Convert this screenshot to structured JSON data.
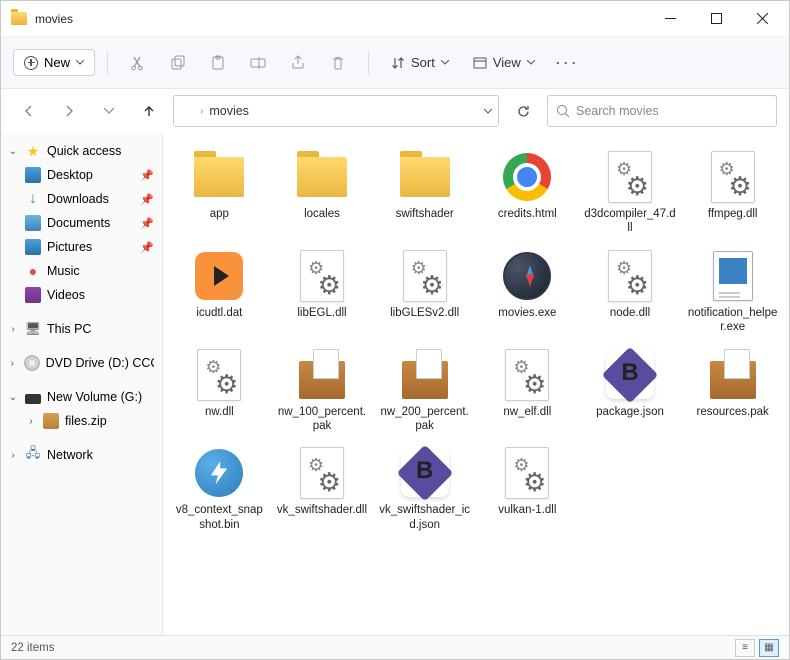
{
  "window": {
    "title": "movies"
  },
  "toolbar": {
    "new_label": "New",
    "sort_label": "Sort",
    "view_label": "View"
  },
  "address": {
    "crumb": "movies"
  },
  "search": {
    "placeholder": "Search movies"
  },
  "sidebar": {
    "quick_access": "Quick access",
    "desktop": "Desktop",
    "downloads": "Downloads",
    "documents": "Documents",
    "pictures": "Pictures",
    "music": "Music",
    "videos": "Videos",
    "this_pc": "This PC",
    "dvd": "DVD Drive (D:) CCCC",
    "new_volume": "New Volume (G:)",
    "files_zip": "files.zip",
    "network": "Network"
  },
  "files": [
    {
      "name": "app",
      "type": "folder"
    },
    {
      "name": "locales",
      "type": "folder"
    },
    {
      "name": "swiftshader",
      "type": "folder"
    },
    {
      "name": "credits.html",
      "type": "chrome"
    },
    {
      "name": "d3dcompiler_47.dll",
      "type": "gear"
    },
    {
      "name": "ffmpeg.dll",
      "type": "gear"
    },
    {
      "name": "icudtl.dat",
      "type": "play"
    },
    {
      "name": "libEGL.dll",
      "type": "gear"
    },
    {
      "name": "libGLESv2.dll",
      "type": "gear"
    },
    {
      "name": "movies.exe",
      "type": "compass"
    },
    {
      "name": "node.dll",
      "type": "gear"
    },
    {
      "name": "notification_helper.exe",
      "type": "doc"
    },
    {
      "name": "nw.dll",
      "type": "gear"
    },
    {
      "name": "nw_100_percent.pak",
      "type": "box"
    },
    {
      "name": "nw_200_percent.pak",
      "type": "box"
    },
    {
      "name": "nw_elf.dll",
      "type": "gear"
    },
    {
      "name": "package.json",
      "type": "bbedit"
    },
    {
      "name": "resources.pak",
      "type": "box"
    },
    {
      "name": "v8_context_snapshot.bin",
      "type": "daemon"
    },
    {
      "name": "vk_swiftshader.dll",
      "type": "gear"
    },
    {
      "name": "vk_swiftshader_icd.json",
      "type": "bbedit"
    },
    {
      "name": "vulkan-1.dll",
      "type": "gear"
    }
  ],
  "status": {
    "items": "22 items"
  }
}
